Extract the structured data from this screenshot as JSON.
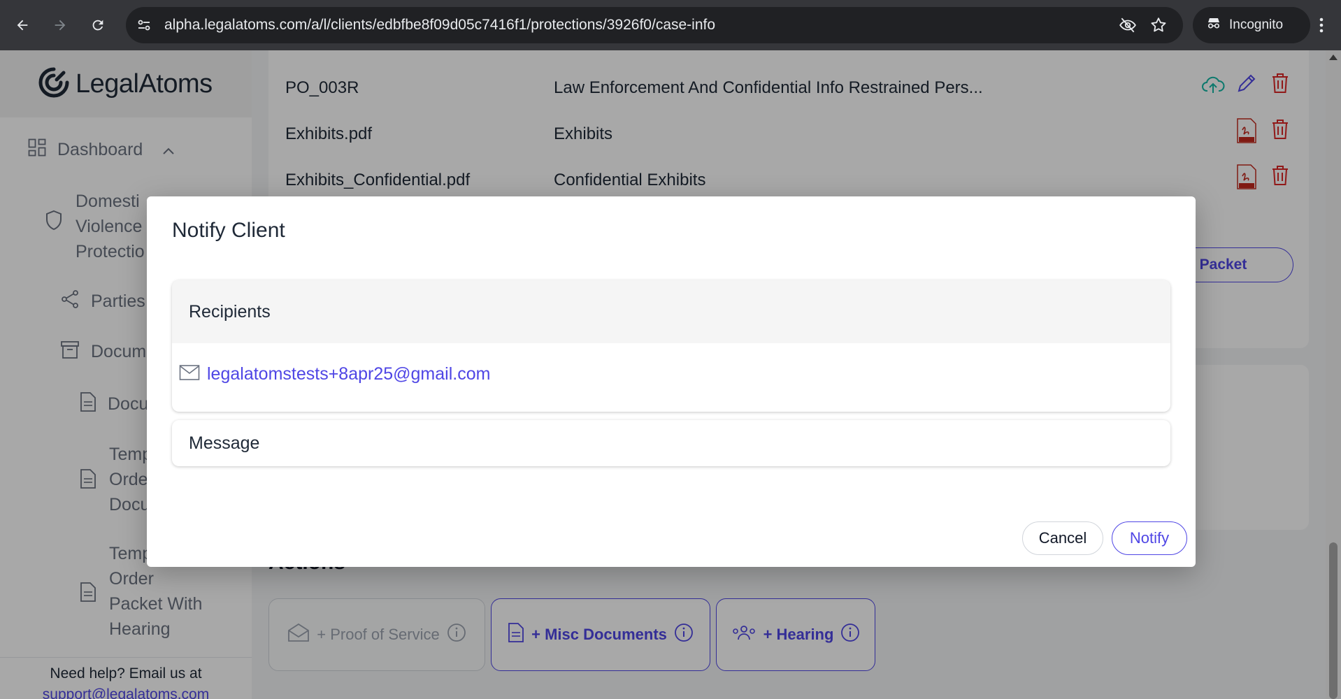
{
  "browser": {
    "url": "alpha.legalatoms.com/a/l/clients/edbfbe8f09d05c7416f1/protections/3926f0/case-info",
    "profile_label": "Incognito"
  },
  "sidebar": {
    "logo_text": "LegalAtoms",
    "dashboard_label": "Dashboard",
    "items": [
      {
        "label": "Domestic Violence Protection",
        "lines": [
          "Domesti",
          "Violence",
          "Protectio"
        ]
      },
      {
        "label": "Parties"
      },
      {
        "label": "Docum"
      },
      {
        "label": "Docu"
      },
      {
        "label": "Temp Order Docu",
        "lines": [
          "Temp",
          "Orde",
          "Docu"
        ]
      },
      {
        "label": "Temp Order Packet With Hearing",
        "lines": [
          "Temp",
          "Order",
          "Packet With",
          "Hearing"
        ]
      }
    ],
    "help_text": "Need help? Email us at",
    "help_link": "support@legalatoms.com"
  },
  "documents": {
    "rows": [
      {
        "name": "PO_003R",
        "description": "Law Enforcement And Confidential Info Restrained Pers..."
      },
      {
        "name": "Exhibits.pdf",
        "description": "Exhibits"
      },
      {
        "name": "Exhibits_Confidential.pdf",
        "description": "Confidential Exhibits"
      }
    ],
    "packet_button": "le to Packet"
  },
  "actions": {
    "heading": "Actions",
    "buttons": [
      {
        "label": "+ Proof of Service",
        "enabled": false
      },
      {
        "label": "+ Misc Documents",
        "enabled": true
      },
      {
        "label": "+ Hearing",
        "enabled": true
      }
    ]
  },
  "modal": {
    "title": "Notify Client",
    "recipients_heading": "Recipients",
    "recipient_email": "legalatomstests+8apr25@gmail.com",
    "message_heading": "Message",
    "cancel_label": "Cancel",
    "notify_label": "Notify"
  },
  "colors": {
    "accent": "#4f46e5",
    "delete": "#dc2626",
    "upload": "#14b8a6"
  }
}
